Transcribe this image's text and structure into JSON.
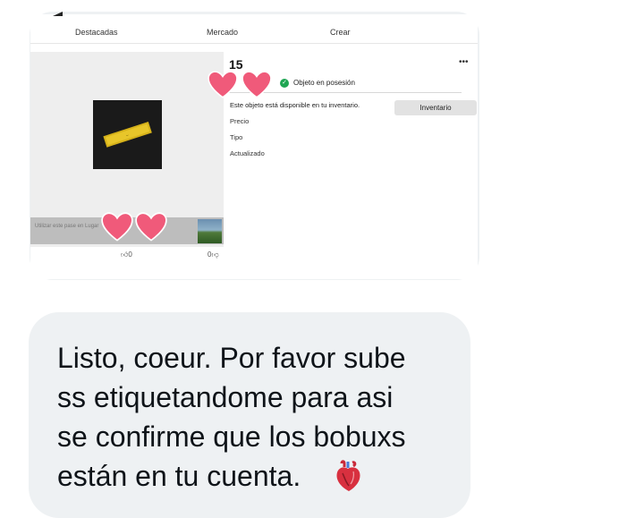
{
  "tabs": [
    "Destacadas",
    "Mercado",
    "Crear"
  ],
  "item": {
    "title": "15",
    "owned_label": "Objeto en posesión",
    "available_text": "Este objeto está disponible en tu inventario.",
    "inventory_button": "Inventario",
    "labels": [
      "Precio",
      "Tipo",
      "Actualizado"
    ],
    "strip_text": "Utilizar este pase en Lugar",
    "likes": "0",
    "dislikes": "0",
    "more_icon": "more-dots-icon"
  },
  "message": {
    "text": "Listo, coeur. Por favor sube\nss etiquetandome para asi\nse confirme que los bobuxs\nestán en tu cuenta.",
    "emoji": "anatomical-heart-icon"
  },
  "colors": {
    "bubble": "#eef1f3",
    "heart_sticker": "#f05a7a",
    "owned_badge": "#1fa653"
  }
}
